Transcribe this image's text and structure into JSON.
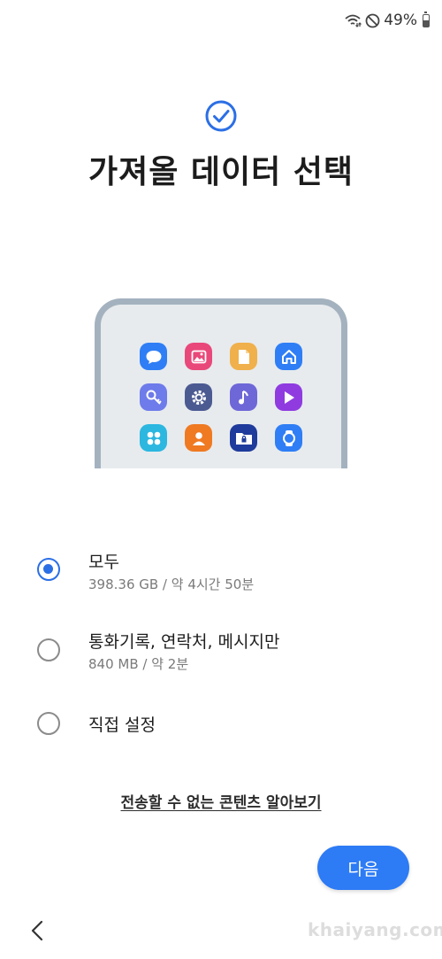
{
  "status_bar": {
    "battery_text": "49%",
    "battery_level": 0.49,
    "icons": [
      "wifi-icon",
      "do-not-disturb-icon",
      "battery-icon"
    ]
  },
  "header": {
    "title": "가져올 데이터 선택",
    "icon": "check-circle-icon",
    "accent_color": "#2b6fe5"
  },
  "illustration": {
    "apps": [
      {
        "name": "messages-app-icon",
        "color": "#2f7ef5"
      },
      {
        "name": "gallery-app-icon",
        "color": "#e9487a"
      },
      {
        "name": "files-app-icon",
        "color": "#f0b04b"
      },
      {
        "name": "home-app-icon",
        "color": "#2f7ef5"
      },
      {
        "name": "key-app-icon",
        "color": "#6e7bea"
      },
      {
        "name": "settings-app-icon",
        "color": "#4c5a92"
      },
      {
        "name": "music-app-icon",
        "color": "#6e67d8"
      },
      {
        "name": "video-app-icon",
        "color": "#8f3be0"
      },
      {
        "name": "apps-app-icon",
        "color": "#2bb7e0"
      },
      {
        "name": "contacts-app-icon",
        "color": "#ef7a22"
      },
      {
        "name": "secure-folder-app-icon",
        "color": "#1f3b9b"
      },
      {
        "name": "watch-app-icon",
        "color": "#2f7ef5"
      }
    ]
  },
  "options": [
    {
      "label": "모두",
      "sub": "398.36 GB / 약 4시간 50분",
      "checked": true
    },
    {
      "label": "통화기록, 연락처, 메시지만",
      "sub": "840 MB / 약 2분",
      "checked": false
    },
    {
      "label": "직접 설정",
      "sub": "",
      "checked": false
    }
  ],
  "learn_more_link": "전송할 수 없는 콘텐츠 알아보기",
  "next_button": "다음",
  "navigation": {
    "back_icon": "chevron-left-icon"
  },
  "watermark": "khaiyang.com"
}
